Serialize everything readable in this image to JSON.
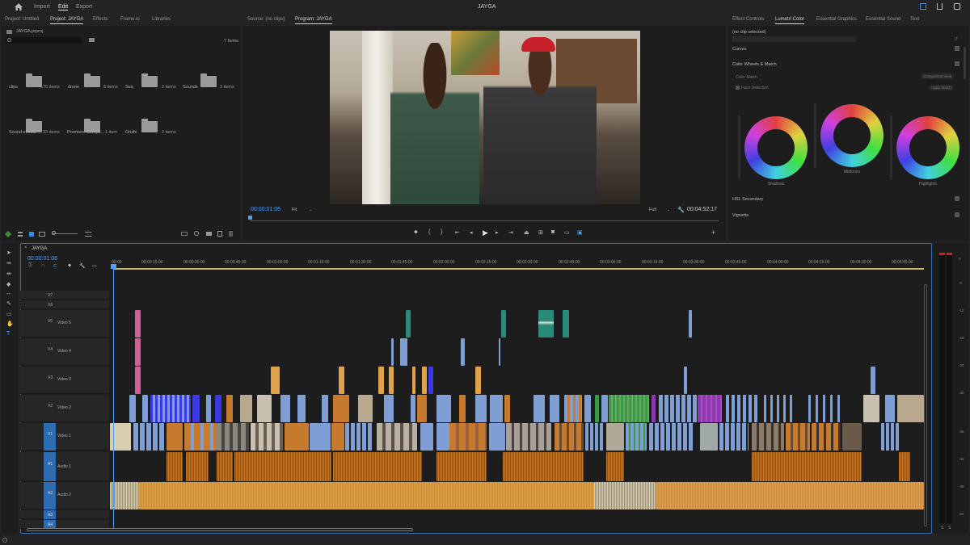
{
  "app": {
    "title": "JAYGA",
    "nav": [
      {
        "label": "Import",
        "active": false
      },
      {
        "label": "Edit",
        "active": true
      },
      {
        "label": "Export",
        "active": false
      }
    ]
  },
  "project_panel": {
    "tabs": [
      "Project: Untitled",
      "Project: JAYGA",
      "Effects",
      "Frame.io",
      "Libraries"
    ],
    "active_tab": "Project: JAYGA",
    "file": "JAYGA.prproj",
    "item_count": "7 Items",
    "bins": [
      {
        "name": "clips",
        "count": "170 items"
      },
      {
        "name": "drone",
        "count": "8 items"
      },
      {
        "name": "Seq",
        "count": "2 items"
      },
      {
        "name": "Sounds",
        "count": "3 items"
      },
      {
        "name": "Sound effects",
        "count": "33 items"
      },
      {
        "name": "Premiere Compo...",
        "count": "1 item"
      },
      {
        "name": "Orishi",
        "count": "2 items"
      }
    ]
  },
  "monitor": {
    "tabs": [
      "Source: (no clips)",
      "Program: JAYGA"
    ],
    "active_tab": "Program: JAYGA",
    "timecode": "00:00:01:06",
    "fit": "Fit",
    "quality": "Full",
    "duration": "00:04:52:17"
  },
  "lumetri": {
    "tabs": [
      "Effect Controls",
      "Lumetri Color",
      "Essential Graphics",
      "Essential Sound",
      "Text"
    ],
    "active_tab": "Lumetri Color",
    "clip": "(no clip selected)",
    "sections": [
      "Curves",
      "Color Wheels & Match",
      "HSL Secondary",
      "Vignette"
    ],
    "color_match": "Color Match",
    "comparison_view": "Comparison View",
    "face_detection": "Face Detection",
    "apply_match": "Apply Match",
    "wheels": [
      "Shadows",
      "Midtones",
      "Highlights"
    ]
  },
  "timeline": {
    "tab": "JAYGA",
    "timecode": "00:00:01:06",
    "ruler": [
      "00:00",
      "00:00:15:00",
      "00:00:30:00",
      "00:00:45:00",
      "00:01:00:00",
      "00:01:15:00",
      "00:01:30:00",
      "00:01:45:00",
      "00:02:00:00",
      "00:02:15:00",
      "00:02:30:00",
      "00:02:45:00",
      "00:03:00:00",
      "00:03:15:00",
      "00:03:30:00",
      "00:03:45:00",
      "00:04:00:00",
      "00:04:15:00",
      "00:04:30:00",
      "00:04:45:00"
    ],
    "tracks": [
      {
        "code": "V7",
        "name": ""
      },
      {
        "code": "V6",
        "name": ""
      },
      {
        "code": "V5",
        "name": "Video 5"
      },
      {
        "code": "V4",
        "name": "Video 4"
      },
      {
        "code": "V3",
        "name": "Video 3"
      },
      {
        "code": "V2",
        "name": "Video 2"
      },
      {
        "code": "V1",
        "name": "Video 1"
      },
      {
        "code": "A1",
        "name": "Audio 1"
      },
      {
        "code": "A2",
        "name": "Audio 2"
      },
      {
        "code": "A3",
        "name": ""
      },
      {
        "code": "A4",
        "name": ""
      }
    ],
    "meter_labels": [
      "0",
      "-6",
      "-12",
      "-18",
      "-24",
      "-30",
      "-36",
      "-42",
      "-48",
      "-54"
    ],
    "meter_solo": [
      "S",
      "S"
    ]
  },
  "colors": {
    "accent": "#2d8ceb",
    "video_clip": "#7f9fd4",
    "audio_clip": "#c67a2e",
    "music_clip": "#e0a34a",
    "pink": "#d35e9a",
    "teal": "#2a8a7a",
    "orange_v3": "#e0a34a",
    "purple": "#8a3ab0",
    "green": "#3a9a4a",
    "blue_deep": "#3a3ae0"
  }
}
